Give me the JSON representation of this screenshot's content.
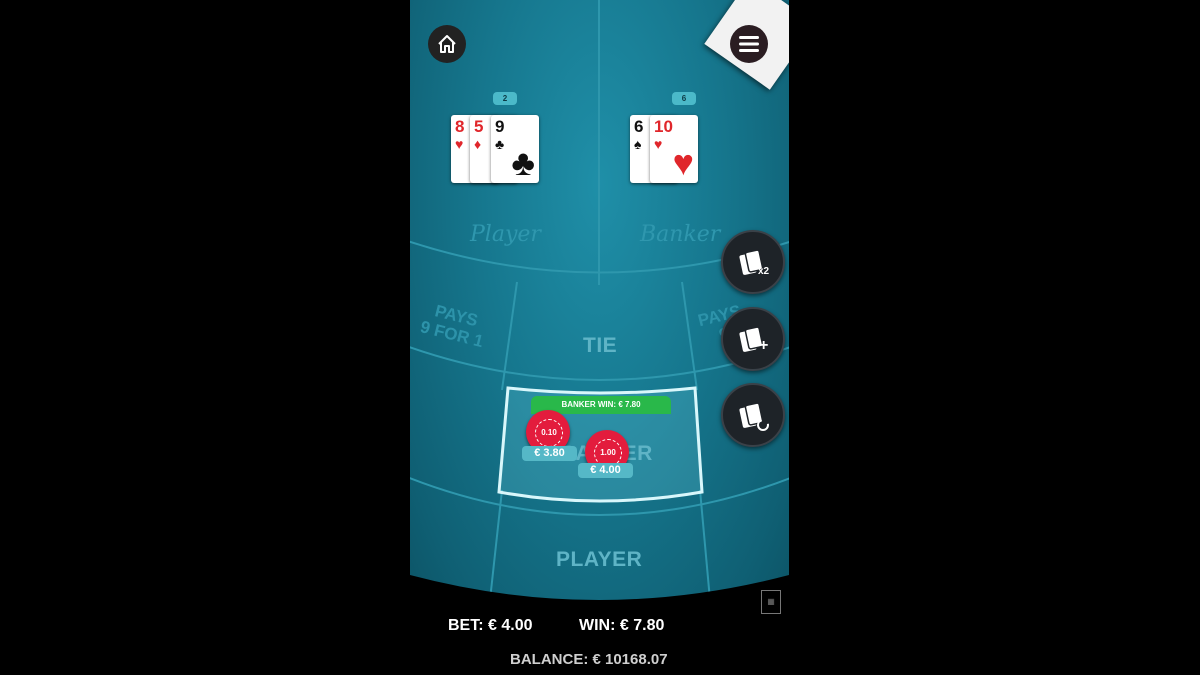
{
  "player_hand": {
    "score": "2",
    "cards": [
      {
        "rank": "8",
        "suit": "♥",
        "color": "red"
      },
      {
        "rank": "5",
        "suit": "♦",
        "color": "red"
      },
      {
        "rank": "9",
        "suit": "♣",
        "color": "black"
      }
    ]
  },
  "banker_hand": {
    "score": "6",
    "cards": [
      {
        "rank": "6",
        "suit": "♠",
        "color": "black"
      },
      {
        "rank": "10",
        "suit": "♥",
        "color": "red"
      }
    ]
  },
  "table": {
    "player_script": "Player",
    "banker_script": "Banker",
    "pays_left": "PAYS\n9 FOR 1",
    "pays_right": "PAYS\n9",
    "tie_label": "TIE",
    "banker_label": "BANKER",
    "player_label": "PLAYER"
  },
  "win_banner": "BANKER WIN: € 7.80",
  "chips": [
    {
      "value": "0.10",
      "amount": "€ 3.80"
    },
    {
      "value": "1.00",
      "amount": "€ 4.00"
    }
  ],
  "side_buttons": {
    "double": {
      "icon": "cards-x2-icon",
      "text": "x2"
    },
    "add": {
      "icon": "cards-plus-icon",
      "text": "+"
    },
    "rebet": {
      "icon": "cards-repeat-icon",
      "text": ""
    }
  },
  "hud": {
    "bet": "BET: € 4.00",
    "win": "WIN: € 7.80",
    "balance": "BALANCE: € 10168.07"
  },
  "colors": {
    "felt": "#16778e",
    "win_green": "#29b84a",
    "chip_red": "#e31c3d"
  }
}
